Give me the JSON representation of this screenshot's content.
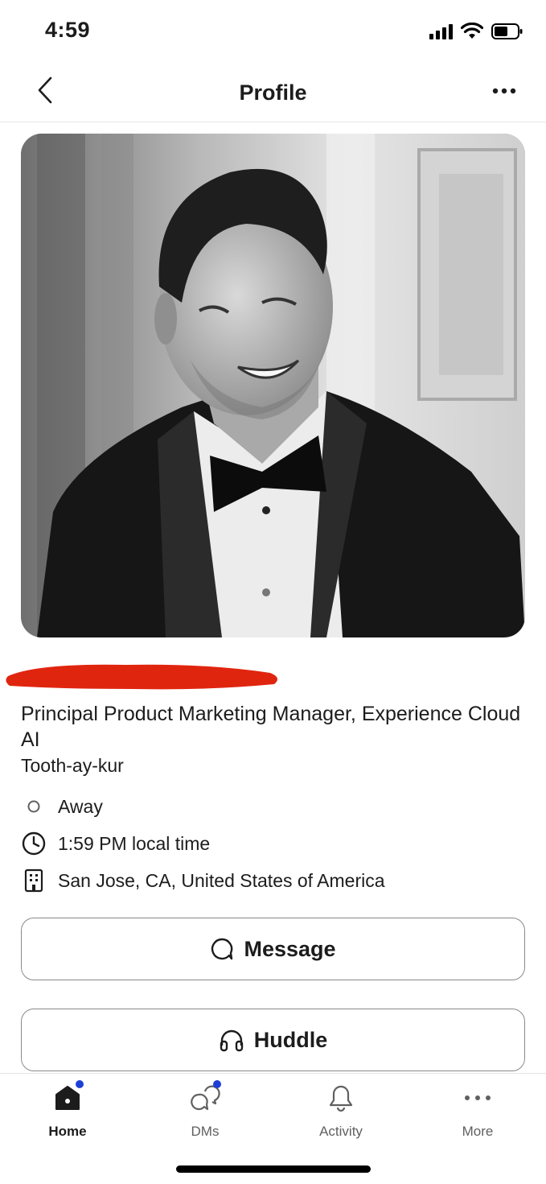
{
  "status_bar": {
    "time": "4:59"
  },
  "header": {
    "title": "Profile"
  },
  "profile": {
    "title": "Principal Product Marketing Manager, Experience Cloud AI",
    "pronunciation": "Tooth-ay-kur",
    "status": "Away",
    "local_time": "1:59 PM local time",
    "location": "San Jose, CA, United States of America"
  },
  "actions": {
    "message_label": "Message",
    "huddle_label": "Huddle"
  },
  "tabs": [
    {
      "label": "Home",
      "icon": "home-icon",
      "active": true,
      "badge": true
    },
    {
      "label": "DMs",
      "icon": "dms-icon",
      "active": false,
      "badge": true
    },
    {
      "label": "Activity",
      "icon": "bell-icon",
      "active": false,
      "badge": false
    },
    {
      "label": "More",
      "icon": "more-icon",
      "active": false,
      "badge": false
    }
  ],
  "colors": {
    "badge": "#1d3fd8",
    "redaction": "#e0250f",
    "text": "#1d1c1d",
    "muted": "#616061"
  }
}
